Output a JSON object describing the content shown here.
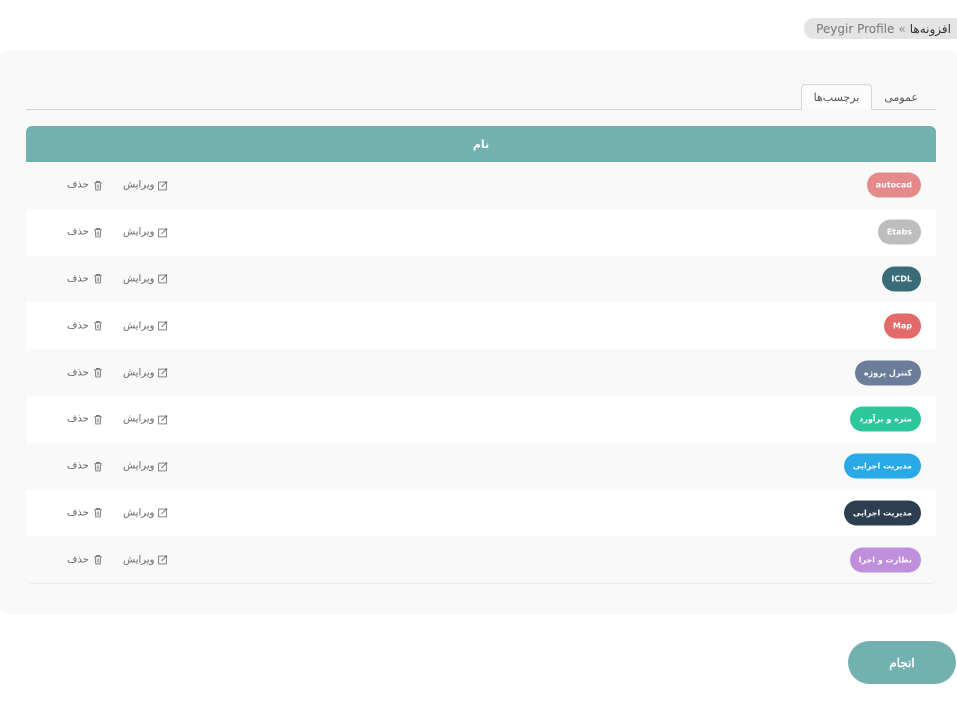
{
  "breadcrumb": {
    "current": "افزونه‌ها",
    "separator": "»",
    "link": "Peygir Profile"
  },
  "tabs": [
    {
      "label": "عمومی",
      "active": false
    },
    {
      "label": "برچسب‌ها",
      "active": true
    }
  ],
  "table": {
    "header": "نام",
    "rows": [
      {
        "tag": "autocad",
        "color": "#e58a8a",
        "edit_label": "ویرایش",
        "delete_label": "حذف"
      },
      {
        "tag": "Etabs",
        "color": "#bdbdbd",
        "edit_label": "ویرایش",
        "delete_label": "حذف"
      },
      {
        "tag": "ICDL",
        "color": "#3a6b78",
        "edit_label": "ویرایش",
        "delete_label": "حذف"
      },
      {
        "tag": "Map",
        "color": "#e26a6a",
        "edit_label": "ویرایش",
        "delete_label": "حذف"
      },
      {
        "tag": "کنترل پروژه",
        "color": "#6c7d9a",
        "edit_label": "ویرایش",
        "delete_label": "حذف"
      },
      {
        "tag": "متره و برآورد",
        "color": "#2ec79b",
        "edit_label": "ویرایش",
        "delete_label": "حذف"
      },
      {
        "tag": "مدیریت اجرایی",
        "color": "#29a9e6",
        "edit_label": "ویرایش",
        "delete_label": "حذف"
      },
      {
        "tag": "مدیریت اجرایی",
        "color": "#2c3e50",
        "edit_label": "ویرایش",
        "delete_label": "حذف"
      },
      {
        "tag": "نظارت و اجرا",
        "color": "#c08fdc",
        "edit_label": "ویرایش",
        "delete_label": "حذف"
      }
    ]
  },
  "done_button": "انجام",
  "accent_color": "#73b1b1"
}
